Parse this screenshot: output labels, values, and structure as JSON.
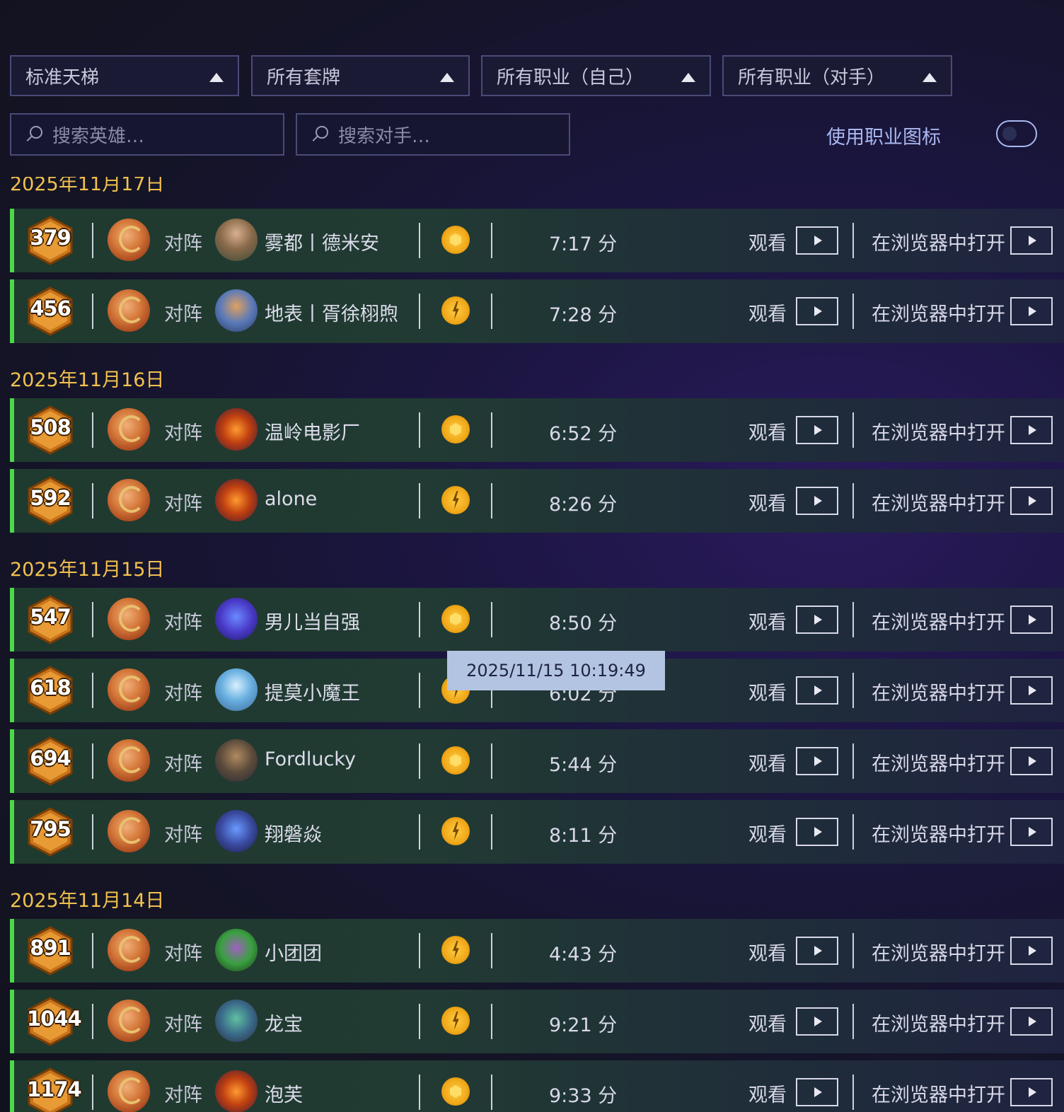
{
  "filters": {
    "mode": "标准天梯",
    "deck": "所有套牌",
    "my_class": "所有职业（自己）",
    "opp_class": "所有职业（对手）"
  },
  "search": {
    "hero_placeholder": "搜索英雄…",
    "opponent_placeholder": "搜索对手…"
  },
  "toggle": {
    "label": "使用职业图标",
    "on": false
  },
  "labels": {
    "vs": "对阵",
    "watch": "观看",
    "open_browser": "在浏览器中打开"
  },
  "partial_date": "2025年11月17日",
  "groups": [
    {
      "date": "2025年11月17日",
      "games": [
        {
          "rank": "379",
          "opponent": "雾都丨德米安",
          "coin": "first",
          "duration": "7:17 分"
        },
        {
          "rank": "456",
          "opponent": "地表丨胥徐栩煦",
          "coin": "second",
          "duration": "7:28 分"
        }
      ]
    },
    {
      "date": "2025年11月16日",
      "games": [
        {
          "rank": "508",
          "opponent": "温岭电影厂",
          "coin": "first",
          "duration": "6:52 分"
        },
        {
          "rank": "592",
          "opponent": "alone",
          "coin": "second",
          "duration": "8:26 分"
        }
      ]
    },
    {
      "date": "2025年11月15日",
      "games": [
        {
          "rank": "547",
          "opponent": "男儿当自强",
          "coin": "first",
          "duration": "8:50 分"
        },
        {
          "rank": "618",
          "opponent": "提莫小魔王",
          "coin": "second",
          "duration": "6:02 分"
        },
        {
          "rank": "694",
          "opponent": "Fordlucky",
          "coin": "first",
          "duration": "5:44 分"
        },
        {
          "rank": "795",
          "opponent": "翔磐焱",
          "coin": "second",
          "duration": "8:11 分"
        }
      ]
    },
    {
      "date": "2025年11月14日",
      "games": [
        {
          "rank": "891",
          "opponent": "小团团",
          "coin": "second",
          "duration": "4:43 分"
        },
        {
          "rank": "1044",
          "opponent": "龙宝",
          "coin": "second",
          "duration": "9:21 分"
        },
        {
          "rank": "1174",
          "opponent": "泡芙",
          "coin": "first",
          "duration": "9:33 分"
        }
      ]
    }
  ],
  "tooltip": "2025/11/15 10:19:49",
  "colors": {
    "accent_win": "#4cd84a",
    "date": "#f2c14e",
    "toggle": "#a9b8ef",
    "tooltip_bg": "#b3c4e2"
  }
}
